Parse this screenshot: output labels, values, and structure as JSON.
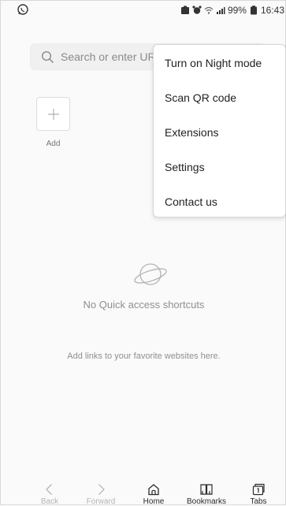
{
  "status_bar": {
    "battery_percent": "99%",
    "time": "16:43"
  },
  "search": {
    "placeholder": "Search or enter URL"
  },
  "shortcuts": {
    "add_label": "Add"
  },
  "empty_state": {
    "title": "No Quick access shortcuts",
    "description": "Add links to your favorite websites here."
  },
  "menu": {
    "items": [
      {
        "label": "Turn on Night mode"
      },
      {
        "label": "Scan QR code"
      },
      {
        "label": "Extensions"
      },
      {
        "label": "Settings"
      },
      {
        "label": "Contact us"
      }
    ]
  },
  "bottom_nav": {
    "items": [
      {
        "label": "Back",
        "icon": "chevron-left-icon"
      },
      {
        "label": "Forward",
        "icon": "chevron-right-icon"
      },
      {
        "label": "Home",
        "icon": "home-icon"
      },
      {
        "label": "Bookmarks",
        "icon": "bookmarks-icon"
      },
      {
        "label": "Tabs",
        "icon": "tabs-icon"
      }
    ]
  },
  "colors": {
    "menu_text": "#1f1f1f",
    "muted_text": "#8f8f8f",
    "disabled_nav": "#b5b5b5"
  }
}
